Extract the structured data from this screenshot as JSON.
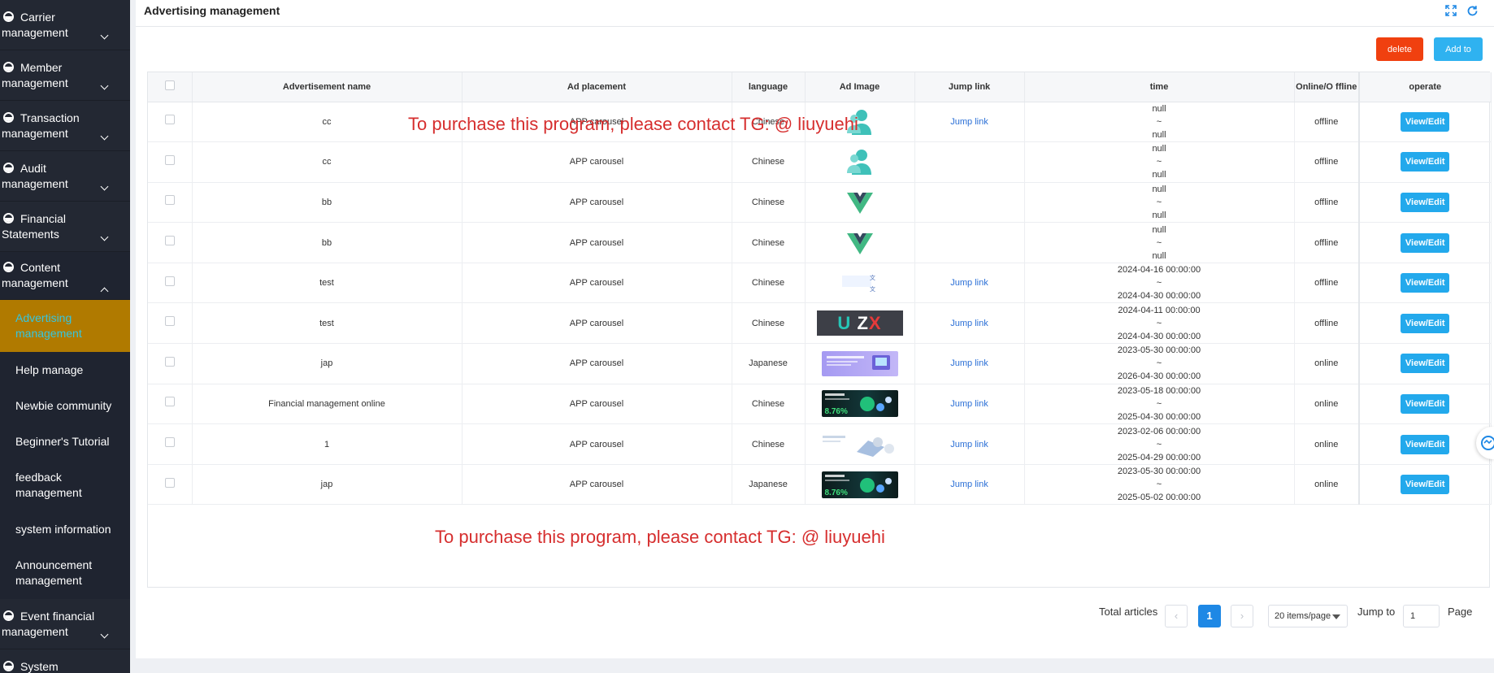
{
  "sidebar": {
    "groups": [
      {
        "label": "Carrier management"
      },
      {
        "label": "Member management"
      },
      {
        "label": "Transaction management"
      },
      {
        "label": "Audit management"
      },
      {
        "label": "Financial Statements"
      },
      {
        "label": "Content management"
      },
      {
        "label": "Event financial management"
      },
      {
        "label": "System Management"
      }
    ],
    "content_items": [
      {
        "label": "Advertising management"
      },
      {
        "label": "Help manage"
      },
      {
        "label": "Newbie community"
      },
      {
        "label": "Beginner's Tutorial"
      },
      {
        "label": "feedback management"
      },
      {
        "label": "system information"
      },
      {
        "label": "Announcement management"
      }
    ]
  },
  "header": {
    "title": "Advertising management"
  },
  "toolbar": {
    "delete_label": "delete",
    "add_label": "Add to"
  },
  "table": {
    "columns": [
      "Advertisement name",
      "Ad placement",
      "language",
      "Ad Image",
      "Jump link",
      "time",
      "Online/O ffline",
      "operate"
    ],
    "rows": [
      {
        "name": "cc",
        "placement": "APP carousel",
        "language": "Chinese",
        "image": "people-icon",
        "jump": "Jump link",
        "start": "null",
        "sep": "~",
        "end": "null",
        "status": "offline",
        "action": "View/Edit"
      },
      {
        "name": "cc",
        "placement": "APP carousel",
        "language": "Chinese",
        "image": "people-icon",
        "jump": "",
        "start": "null",
        "sep": "~",
        "end": "null",
        "status": "offline",
        "action": "View/Edit"
      },
      {
        "name": "bb",
        "placement": "APP carousel",
        "language": "Chinese",
        "image": "vue-logo",
        "jump": "",
        "start": "null",
        "sep": "~",
        "end": "null",
        "status": "offline",
        "action": "View/Edit"
      },
      {
        "name": "bb",
        "placement": "APP carousel",
        "language": "Chinese",
        "image": "vue-logo",
        "jump": "",
        "start": "null",
        "sep": "~",
        "end": "null",
        "status": "offline",
        "action": "View/Edit"
      },
      {
        "name": "test",
        "placement": "APP carousel",
        "language": "Chinese",
        "image": "test-thumb",
        "jump": "Jump link",
        "start": "2024-04-16 00:00:00",
        "sep": "~",
        "end": "2024-04-30 00:00:00",
        "status": "offline",
        "action": "View/Edit"
      },
      {
        "name": "test",
        "placement": "APP carousel",
        "language": "Chinese",
        "image": "uzx-banner",
        "jump": "Jump link",
        "start": "2024-04-11 00:00:00",
        "sep": "~",
        "end": "2024-04-30 00:00:00",
        "status": "offline",
        "action": "View/Edit"
      },
      {
        "name": "jap",
        "placement": "APP carousel",
        "language": "Japanese",
        "image": "jp-banner",
        "jump": "Jump link",
        "start": "2023-05-30 00:00:00",
        "sep": "~",
        "end": "2026-04-30 00:00:00",
        "status": "online",
        "action": "View/Edit"
      },
      {
        "name": "Financial management online",
        "placement": "APP carousel",
        "language": "Chinese",
        "image": "finance-banner",
        "jump": "Jump link",
        "start": "2023-05-18 00:00:00",
        "sep": "~",
        "end": "2025-04-30 00:00:00",
        "status": "online",
        "action": "View/Edit"
      },
      {
        "name": "1",
        "placement": "APP carousel",
        "language": "Chinese",
        "image": "light-banner",
        "jump": "Jump link",
        "start": "2023-02-06 00:00:00",
        "sep": "~",
        "end": "2025-04-29 00:00:00",
        "status": "online",
        "action": "View/Edit"
      },
      {
        "name": "jap",
        "placement": "APP carousel",
        "language": "Japanese",
        "image": "finance-banner",
        "jump": "Jump link",
        "start": "2023-05-30 00:00:00",
        "sep": "~",
        "end": "2025-05-02 00:00:00",
        "status": "online",
        "action": "View/Edit"
      }
    ]
  },
  "thumbs": {
    "uzx_u": "U",
    "uzx_z": "Z",
    "uzx_x": "X",
    "finance_pct": "8.76%"
  },
  "watermark": {
    "text": "To purchase this program, please contact TG: @ liuyuehi"
  },
  "pagination": {
    "total_label": "Total articles",
    "prev_icon": "‹",
    "current_page": "1",
    "next_icon": "›",
    "page_size": "20 items/page",
    "jump_label": "Jump to",
    "jump_value": "1",
    "page_label": "Page"
  },
  "colors": {
    "accent": "#23a9ec",
    "delete": "#f0400f",
    "sidebar": "#1f2430",
    "active_bg": "#b07a00",
    "watermark": "#d62e2e"
  }
}
